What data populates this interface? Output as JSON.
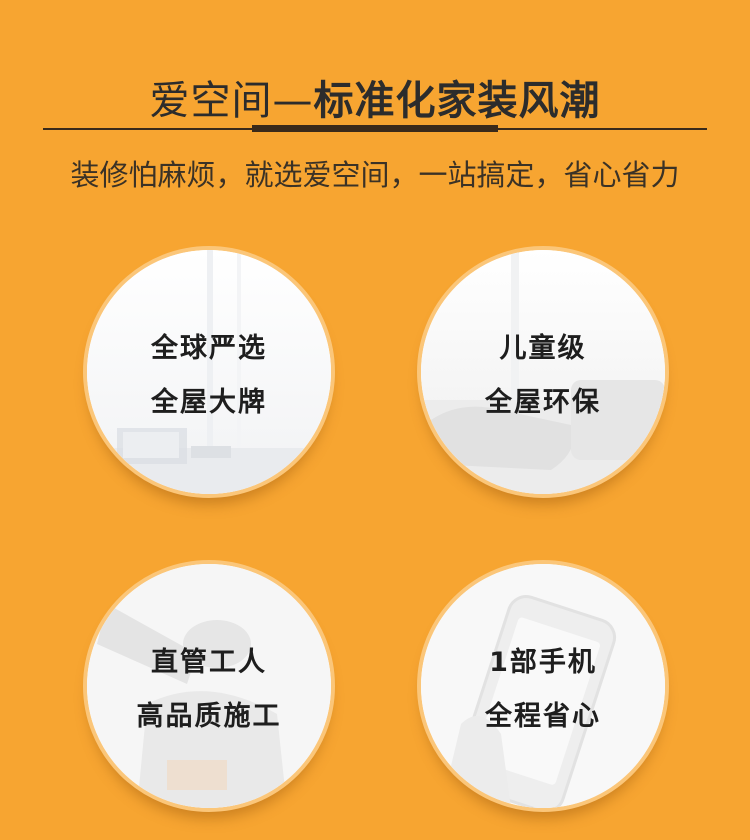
{
  "header": {
    "title_normal": "爱空间—",
    "title_bold": "标准化家装风潮",
    "subtitle": "装修怕麻烦，就选爱空间，一站搞定，省心省力"
  },
  "features": [
    {
      "line1": "全球严选",
      "line2": "全屋大牌",
      "photo_icon": "office-desk-photo"
    },
    {
      "line1": "儿童级",
      "line2": "全屋环保",
      "photo_icon": "sofa-pillow-photo"
    },
    {
      "line1": "直管工人",
      "line2": "高品质施工",
      "photo_icon": "worker-helmet-photo"
    },
    {
      "line1": "1部手机",
      "line2": "全程省心",
      "photo_icon": "smartphone-hand-photo"
    }
  ],
  "colors": {
    "background": "#f7a531",
    "ring": "#fbc679",
    "text_dark": "#2c2c2c"
  }
}
